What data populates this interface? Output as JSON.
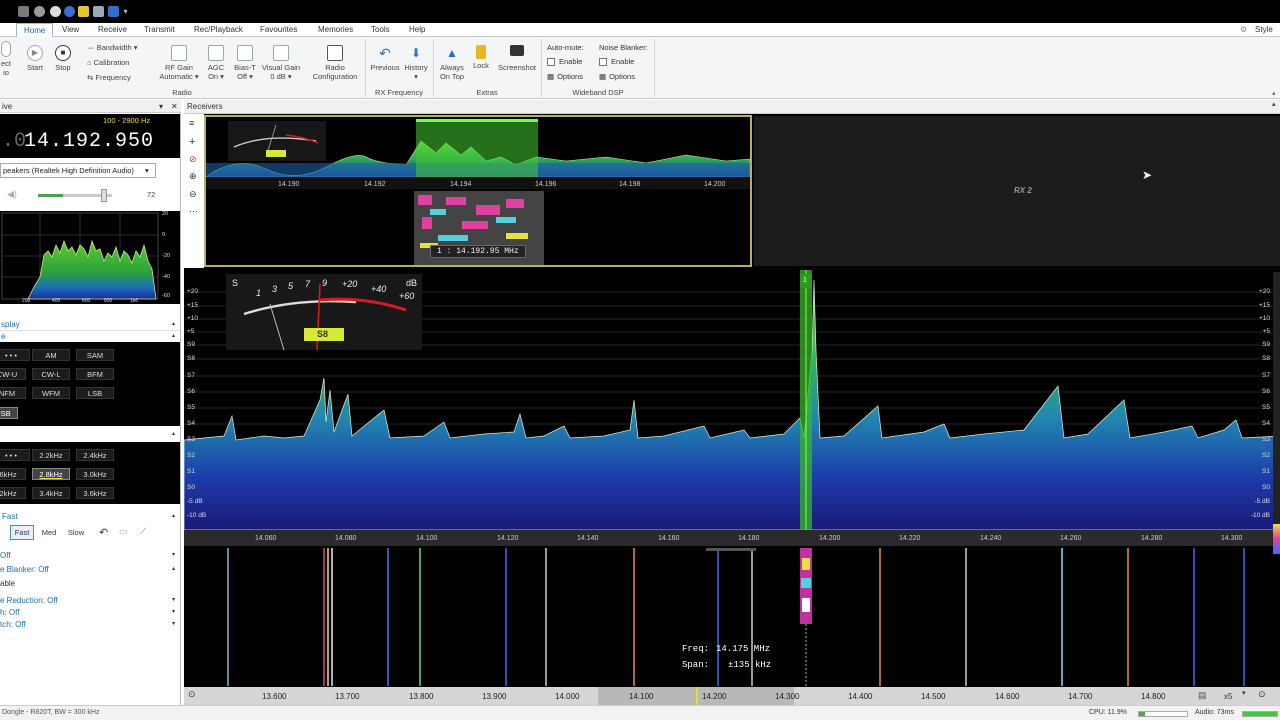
{
  "menu": {
    "items": [
      "Home",
      "View",
      "Receive",
      "Transmit",
      "Rec/Playback",
      "Favourites",
      "Memories",
      "Tools",
      "Help"
    ],
    "style_label": "Style"
  },
  "ribbon": {
    "radio_group": {
      "select_label": "ect\nio",
      "start_label": "Start",
      "stop_label": "Stop",
      "bandwidth_label": "Bandwidth",
      "calibration_label": "Calibration",
      "frequency_label": "Frequency",
      "rf_gain_label": "RF Gain",
      "rf_gain_value": "Automatic",
      "agc_label": "AGC",
      "agc_value": "On",
      "biast_label": "Bias-T",
      "biast_value": "Off",
      "visual_gain_label": "Visual Gain",
      "visual_gain_value": "0 dB",
      "radio_config_label": "Radio Configuration",
      "group_label": "Radio"
    },
    "rx_group": {
      "previous_label": "Previous",
      "history_label": "History",
      "group_label": "RX Frequency"
    },
    "extras_group": {
      "always_label": "Always On Top",
      "lock_label": "Lock",
      "screenshot_label": "Screenshot",
      "group_label": "Extras"
    },
    "dsp_group": {
      "automute_label": "Auto-mute:",
      "noise_blanker_label": "Noise Blanker:",
      "enable_label": "Enable",
      "options_label": "Options",
      "group_label": "Wideband DSP"
    }
  },
  "left": {
    "panel_title": "ive",
    "bandwidth_range": "100 - 2900 Hz",
    "freq_dim": ".0",
    "frequency": "14.192.950",
    "audio_device": "peakers (Realtek High Definition Audio)",
    "volume": "72",
    "display_label": "splay",
    "mode_label": "e",
    "modes": [
      "• • •",
      "AM",
      "SAM",
      "CW-U",
      "CW-L",
      "BFM",
      "NFM",
      "WFM",
      "LSB",
      "USB"
    ],
    "selected_mode": "USB",
    "filters": [
      "• • •",
      "2.2kHz",
      "2.4kHz",
      ".6kHz",
      "2.8kHz",
      "3.0kHz",
      ".2kHz",
      "3.4kHz",
      "3.6kHz"
    ],
    "selected_filter": "2.8kHz",
    "agc_speed_label": "Fast",
    "agc_buttons": [
      "Fast",
      "Med",
      "Slow"
    ],
    "dsp_rows": [
      "Off",
      "e Blanker: Off",
      "able",
      "e Reduction: Off",
      "h: Off",
      "tch: Off"
    ],
    "mini_spec_ticks": [
      "200",
      "400",
      "600",
      "800",
      "1k6"
    ],
    "mini_spec_db": [
      "20",
      "0",
      "-20",
      "-40",
      "-60"
    ]
  },
  "receivers": {
    "title": "Receivers",
    "rx1": {
      "ticks": [
        "14.190",
        "14.192",
        "14.194",
        "14.196",
        "14.198",
        "14.200"
      ],
      "freq_readout": "1 : 14.192.95 MHz"
    },
    "rx2_label": "RX 2",
    "main_ticks": [
      "14.060",
      "14.080",
      "14.100",
      "14.120",
      "14.140",
      "14.160",
      "14.180",
      "14.200",
      "14.220",
      "14.240",
      "14.260",
      "14.280",
      "14.300"
    ],
    "db_left": [
      "+20",
      "+15",
      "+10",
      "+5",
      "S9",
      "S8",
      "S7",
      "S6",
      "S5",
      "S4",
      "S3",
      "S2",
      "S1",
      "S0",
      "-5 dB",
      "-10 dB"
    ],
    "db_right": [
      "+20",
      "+15",
      "+10",
      "+5",
      "S9",
      "S8",
      "S7",
      "S6",
      "S5",
      "S4",
      "S3",
      "S2",
      "S1",
      "S0",
      "-5 dB",
      "-10 dB"
    ],
    "meter": {
      "s_label": "S",
      "db_label": "dB",
      "scale": [
        "1",
        "3",
        "5",
        "7",
        "9",
        "+20",
        "+40",
        "+60"
      ],
      "reading": "S8"
    },
    "marker_label": "1",
    "freq_label": "Freq:",
    "freq_value": "14.175 MHz",
    "span_label": "Span:",
    "span_value": "±135 kHz",
    "overview_ticks": [
      "13.600",
      "13.700",
      "13.800",
      "13.900",
      "14.000",
      "14.100",
      "14.200",
      "14.300",
      "14.400",
      "14.500",
      "14.600",
      "14.700",
      "14.800"
    ],
    "zoom_label": "x5"
  },
  "status": {
    "device": "Dongle - R820T, BW = 300 kHz",
    "cpu": "CPU: 11.9%",
    "audio": "Audio: 73ms"
  },
  "colors": {
    "accent": "#1a6fb0",
    "spectrum_green": "#3fcf2a",
    "marker_green": "#38b52a",
    "meter_red": "#d31c1c",
    "meter_yellow": "#d8e838"
  }
}
